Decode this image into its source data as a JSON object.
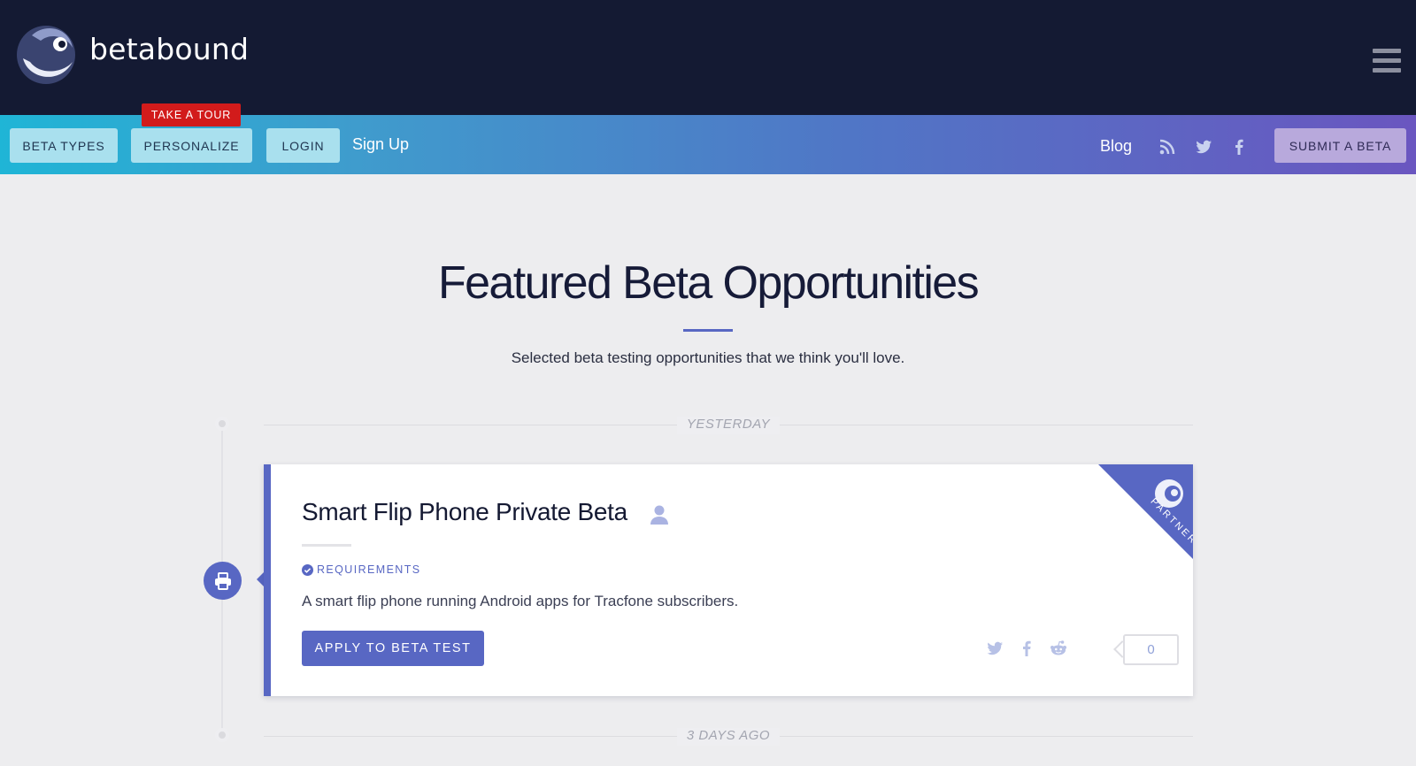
{
  "header": {
    "brand": "betabound",
    "menu_icon": "hamburger-menu-icon"
  },
  "nav": {
    "beta_types": "BETA TYPES",
    "personalize": "PERSONALIZE",
    "tour_tag": "TAKE A TOUR",
    "login": "LOGIN",
    "signup": "Sign Up",
    "blog": "Blog",
    "social_icons": [
      "rss-icon",
      "twitter-icon",
      "facebook-icon"
    ],
    "submit": "SUBMIT A BETA"
  },
  "hero": {
    "title": "Featured Beta Opportunities",
    "subtitle": "Selected beta testing opportunities that we think you'll love."
  },
  "timeline": {
    "groups": [
      {
        "label": "YESTERDAY",
        "cards": [
          {
            "title": "Smart Flip Phone Private Beta",
            "category_icon": "printer-icon",
            "requirements_label": "REQUIREMENTS",
            "description": "A smart flip phone running Android apps for Tracfone subscribers.",
            "apply_label": "APPLY TO BETA TEST",
            "share_icons": [
              "twitter-icon",
              "facebook-icon",
              "reddit-icon"
            ],
            "share_count": "0",
            "partner_label": "PARTNER"
          }
        ]
      },
      {
        "label": "3 DAYS AGO",
        "cards": []
      }
    ]
  },
  "colors": {
    "header_bg": "#141a33",
    "accent": "#5867c3",
    "tour_red": "#d21b1b",
    "page_bg": "#ededef"
  }
}
